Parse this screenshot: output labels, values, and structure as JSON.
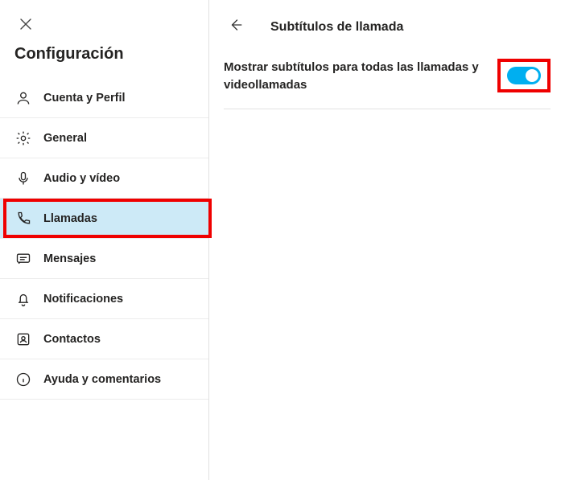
{
  "sidebar": {
    "title": "Configuración",
    "items": [
      {
        "label": "Cuenta y Perfil"
      },
      {
        "label": "General"
      },
      {
        "label": "Audio y vídeo"
      },
      {
        "label": "Llamadas"
      },
      {
        "label": "Mensajes"
      },
      {
        "label": "Notificaciones"
      },
      {
        "label": "Contactos"
      },
      {
        "label": "Ayuda y comentarios"
      }
    ],
    "selected_index": 3
  },
  "main": {
    "title": "Subtítulos de llamada",
    "setting_label": "Mostrar subtítulos para todas las llamadas y videollamadas",
    "toggle_on": true
  },
  "highlights": {
    "sidebar_item": 3,
    "toggle": true
  },
  "colors": {
    "accent": "#00aff0",
    "highlight": "#ef0000",
    "selected_bg": "#cdeaf7"
  }
}
